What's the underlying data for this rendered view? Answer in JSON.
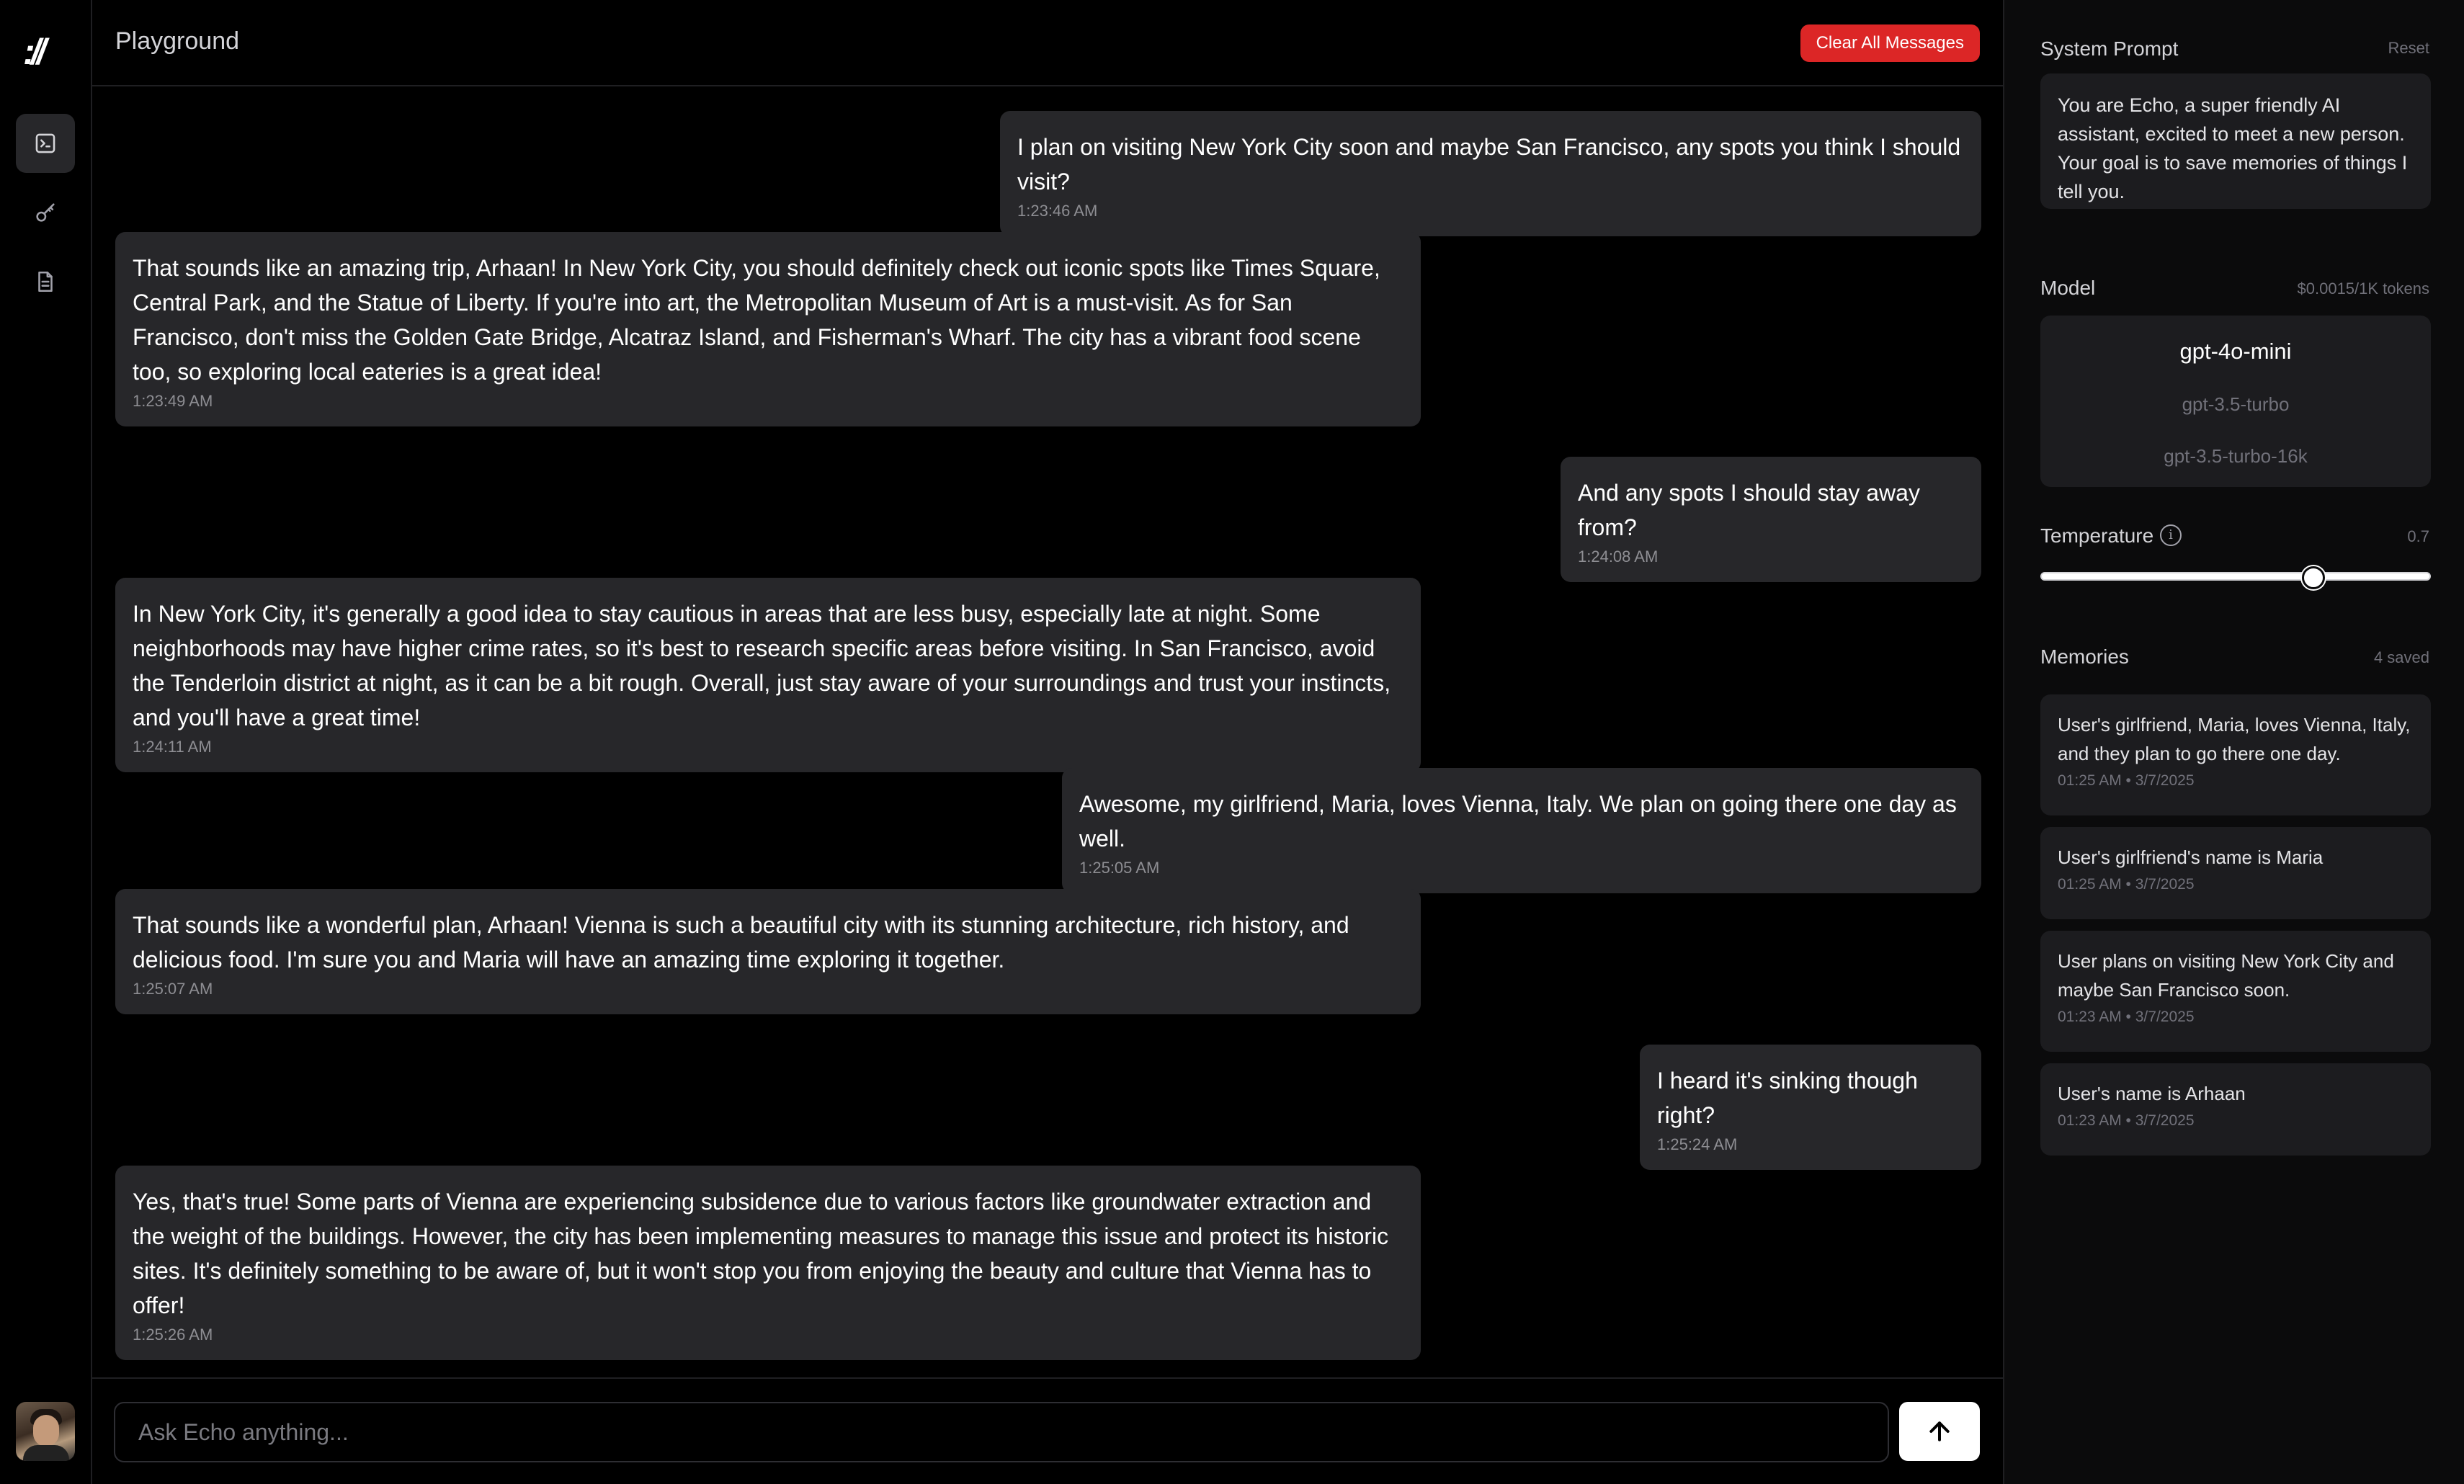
{
  "app": {
    "logo_text": "://",
    "page_title": "Playground"
  },
  "nav": {
    "items": [
      {
        "name": "playground",
        "icon": "terminal-icon",
        "active": true
      },
      {
        "name": "keys",
        "icon": "key-icon",
        "active": false
      },
      {
        "name": "docs",
        "icon": "document-icon",
        "active": false
      }
    ],
    "avatar": "user-avatar"
  },
  "header": {
    "clear_label": "Clear All Messages",
    "clear_color": "#dc2626"
  },
  "messages": [
    {
      "role": "user",
      "text": "I plan on visiting New York City soon and maybe San Francisco, any spots you think I should visit?",
      "time": "1:23:46 AM"
    },
    {
      "role": "assistant",
      "text": "That sounds like an amazing trip, Arhaan! In New York City, you should definitely check out iconic spots like Times Square, Central Park, and the Statue of Liberty. If you're into art, the Metropolitan Museum of Art is a must-visit. As for San Francisco, don't miss the Golden Gate Bridge, Alcatraz Island, and Fisherman's Wharf. The city has a vibrant food scene too, so exploring local eateries is a great idea!",
      "time": "1:23:49 AM"
    },
    {
      "role": "user",
      "text": "And any spots I should stay away from?",
      "time": "1:24:08 AM"
    },
    {
      "role": "assistant",
      "text": "In New York City, it's generally a good idea to stay cautious in areas that are less busy, especially late at night. Some neighborhoods may have higher crime rates, so it's best to research specific areas before visiting. In San Francisco, avoid the Tenderloin district at night, as it can be a bit rough. Overall, just stay aware of your surroundings and trust your instincts, and you'll have a great time!",
      "time": "1:24:11 AM"
    },
    {
      "role": "user",
      "text": "Awesome, my girlfriend, Maria, loves Vienna, Italy. We plan on going there one day as well.",
      "time": "1:25:05 AM"
    },
    {
      "role": "assistant",
      "text": "That sounds like a wonderful plan, Arhaan! Vienna is such a beautiful city with its stunning architecture, rich history, and delicious food. I'm sure you and Maria will have an amazing time exploring it together.",
      "time": "1:25:07 AM"
    },
    {
      "role": "user",
      "text": "I heard it's sinking though right?",
      "time": "1:25:24 AM"
    },
    {
      "role": "assistant",
      "text": "Yes, that's true! Some parts of Vienna are experiencing subsidence due to various factors like groundwater extraction and the weight of the buildings. However, the city has been implementing measures to manage this issue and protect its historic sites. It's definitely something to be aware of, but it won't stop you from enjoying the beauty and culture that Vienna has to offer!",
      "time": "1:25:26 AM"
    }
  ],
  "composer": {
    "placeholder": "Ask Echo anything...",
    "send_icon": "arrow-up-icon"
  },
  "settings": {
    "system_prompt": {
      "label": "System Prompt",
      "reset_label": "Reset",
      "text": "You are Echo, a super friendly AI assistant, excited to meet a new person. Your goal is to save memories of things I tell you."
    },
    "model": {
      "label": "Model",
      "price": "$0.0015/1K tokens",
      "options": [
        "gpt-4o-mini",
        "gpt-3.5-turbo",
        "gpt-3.5-turbo-16k"
      ],
      "selected": "gpt-4o-mini"
    },
    "temperature": {
      "label": "Temperature",
      "value_text": "0.7",
      "value": 0.7,
      "info_icon": "info-icon"
    },
    "memories": {
      "label": "Memories",
      "count_text": "4 saved",
      "items": [
        {
          "text": "User's girlfriend, Maria, loves Vienna, Italy, and they plan to go there one day.",
          "time": "01:25 AM • 3/7/2025"
        },
        {
          "text": "User's girlfriend's name is Maria",
          "time": "01:25 AM • 3/7/2025"
        },
        {
          "text": "User plans on visiting New York City and maybe San Francisco soon.",
          "time": "01:23 AM • 3/7/2025"
        },
        {
          "text": "User's name is Arhaan",
          "time": "01:23 AM • 3/7/2025"
        }
      ]
    }
  }
}
